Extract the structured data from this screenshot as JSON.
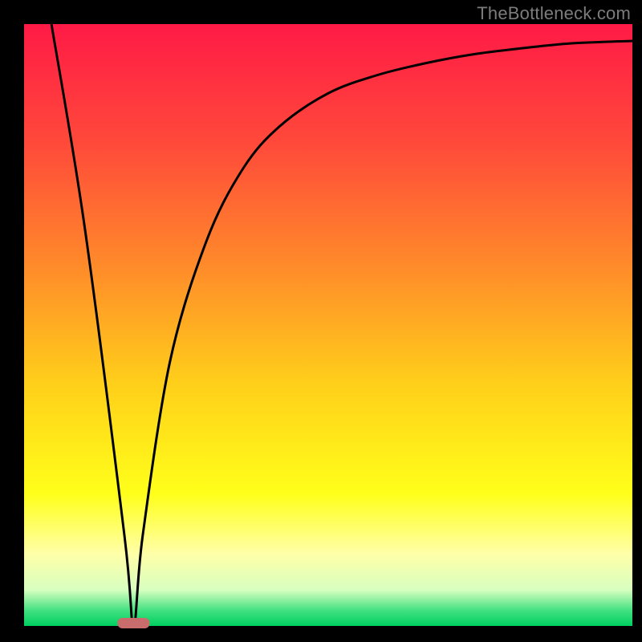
{
  "attribution": "TheBottleneck.com",
  "colors": {
    "background": "#000000",
    "marker": "#c86c6c",
    "gradient_stops": [
      {
        "offset": 0.0,
        "color": "#ff1a46"
      },
      {
        "offset": 0.2,
        "color": "#ff4a3a"
      },
      {
        "offset": 0.4,
        "color": "#ff8a2a"
      },
      {
        "offset": 0.6,
        "color": "#ffd01a"
      },
      {
        "offset": 0.78,
        "color": "#ffff1a"
      },
      {
        "offset": 0.88,
        "color": "#ffffa8"
      },
      {
        "offset": 0.94,
        "color": "#d8ffc0"
      },
      {
        "offset": 0.975,
        "color": "#40e080"
      },
      {
        "offset": 1.0,
        "color": "#00d060"
      }
    ]
  },
  "chart_data": {
    "type": "line",
    "title": "",
    "xlabel": "",
    "ylabel": "",
    "xlim": [
      0,
      100
    ],
    "ylim": [
      0,
      100
    ],
    "grid": false,
    "marker_x": 18,
    "series": [
      {
        "name": "curve",
        "x": [
          4.5,
          10,
          16.5,
          18,
          19.5,
          24,
          30,
          36,
          42,
          50,
          58,
          66,
          74,
          82,
          90,
          100
        ],
        "values": [
          100,
          66,
          15,
          0,
          15,
          44,
          64,
          76,
          83,
          88.5,
          91.5,
          93.5,
          95,
          96,
          96.8,
          97.2
        ]
      }
    ]
  }
}
